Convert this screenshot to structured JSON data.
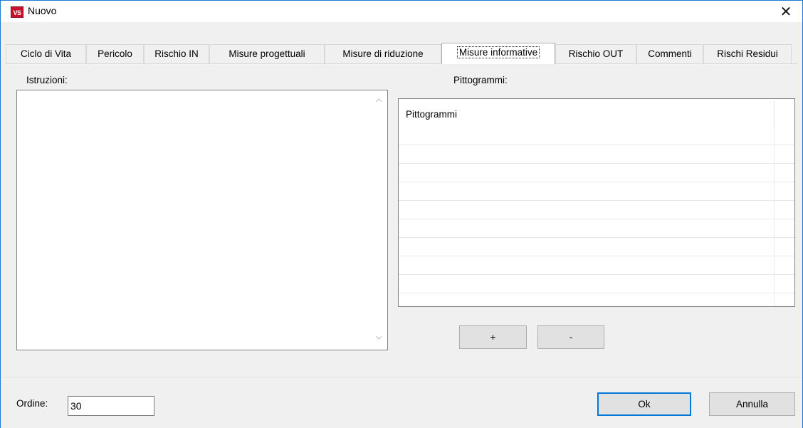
{
  "window": {
    "title": "Nuovo",
    "app_icon_text": "VS",
    "close_glyph": "✕"
  },
  "tabs": [
    {
      "label": "Ciclo di Vita",
      "active": false
    },
    {
      "label": "Pericolo",
      "active": false
    },
    {
      "label": "Rischio IN",
      "active": false
    },
    {
      "label": "Misure progettuali",
      "active": false
    },
    {
      "label": "Misure di riduzione",
      "active": false
    },
    {
      "label": "Misure informative",
      "active": true
    },
    {
      "label": "Rischio OUT",
      "active": false
    },
    {
      "label": "Commenti",
      "active": false
    },
    {
      "label": "Rischi Residui",
      "active": false
    }
  ],
  "istruzioni": {
    "label": "Istruzioni:",
    "value": ""
  },
  "pittogrammi": {
    "label": "Pittogrammi:",
    "column_header": "Pittogrammi",
    "rows": [],
    "add_label": "+",
    "remove_label": "-"
  },
  "footer": {
    "ordine_label": "Ordine:",
    "ordine_value": "30",
    "ok_label": "Ok",
    "cancel_label": "Annulla"
  },
  "colors": {
    "accent": "#0078d7",
    "window_bg": "#f0f0f0",
    "app_icon": "#c8102e"
  },
  "icons": {
    "app": "app-logo-icon",
    "close": "close-icon",
    "scroll_up": "chevron-up-icon",
    "scroll_down": "chevron-down-icon"
  }
}
